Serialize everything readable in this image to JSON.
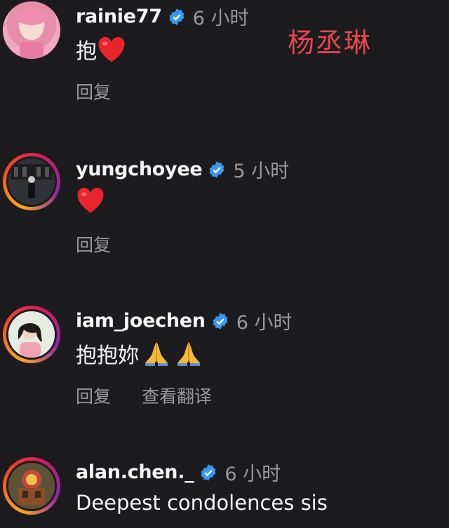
{
  "watermark": "杨丞琳",
  "actions": {
    "reply": "回复",
    "translate": "查看翻译"
  },
  "comments": [
    {
      "username": "rainie77",
      "time": "6 小时",
      "text": "抱"
    },
    {
      "username": "yungchoyee",
      "time": "5 小时",
      "text": ""
    },
    {
      "username": "iam_joechen",
      "time": "6 小时",
      "text": "抱抱妳"
    },
    {
      "username": "alan.chen._",
      "time": "6 小时",
      "text": "Deepest condolences sis"
    }
  ],
  "colors": {
    "background": "#1c1c1e",
    "verified": "#3897f0",
    "muted": "#9a9a9a",
    "watermark": "#e8474f"
  }
}
